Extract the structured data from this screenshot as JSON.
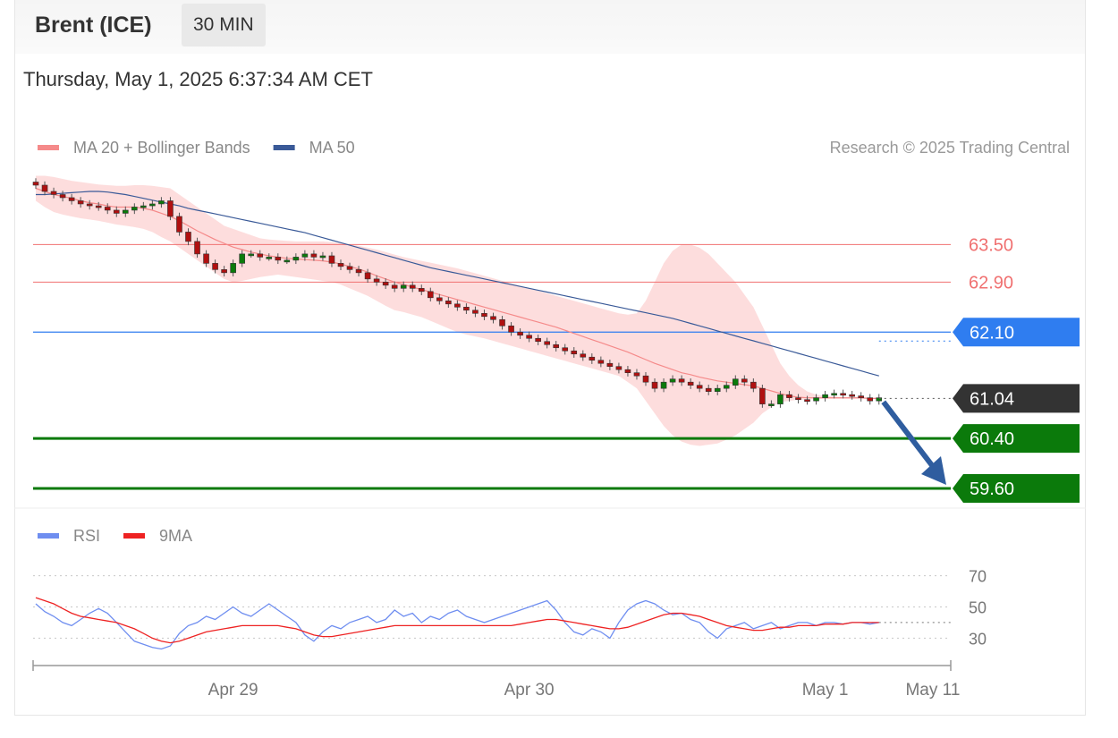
{
  "header": {
    "instrument": "Brent (ICE)",
    "timeframe": "30 MIN",
    "datetime": "Thursday, May 1, 2025 6:37:34 AM CET"
  },
  "copyright": "Research © 2025 Trading Central",
  "colors": {
    "ma20": "#f58a8a",
    "band": "#fcd4d4",
    "ma50": "#3a5a98",
    "resistance": "#f07070",
    "pivot": "#2f7df0",
    "support": "#0b7a0b",
    "price": "#333333",
    "rsi": "#6f8ef0",
    "rsi_ma": "#ee2222",
    "candle_up": "#0b7a0b",
    "candle_down": "#b01010"
  },
  "chart_data": [
    {
      "type": "candlestick",
      "title": "",
      "legend": [
        {
          "name": "MA 20 + Bollinger Bands",
          "color": "#f58a8a"
        },
        {
          "name": "MA 50",
          "color": "#3a5a98"
        }
      ],
      "legend_position": "top-left",
      "ylim": [
        59.4,
        64.55
      ],
      "x_ticks": [
        {
          "label": "Apr 29",
          "index": 22
        },
        {
          "label": "Apr 30",
          "index": 55
        },
        {
          "label": "May 1",
          "index": 88
        },
        {
          "label": "May 11",
          "index": 100
        }
      ],
      "x_range": [
        0,
        102
      ],
      "levels": [
        {
          "value": 63.5,
          "label": "63.50",
          "kind": "resistance"
        },
        {
          "value": 62.9,
          "label": "62.90",
          "kind": "resistance"
        },
        {
          "value": 62.1,
          "label": "62.10",
          "kind": "pivot"
        },
        {
          "value": 61.04,
          "label": "61.04",
          "kind": "price"
        },
        {
          "value": 60.4,
          "label": "60.40",
          "kind": "support"
        },
        {
          "value": 59.6,
          "label": "59.60",
          "kind": "support"
        }
      ],
      "close": [
        64.45,
        64.35,
        64.3,
        64.25,
        64.2,
        64.15,
        64.12,
        64.1,
        64.05,
        64.0,
        64.05,
        64.1,
        64.12,
        64.15,
        64.2,
        63.95,
        63.7,
        63.55,
        63.35,
        63.2,
        63.1,
        63.05,
        63.2,
        63.35,
        63.35,
        63.3,
        63.3,
        63.25,
        63.25,
        63.3,
        63.35,
        63.3,
        63.32,
        63.2,
        63.15,
        63.1,
        63.05,
        62.95,
        62.9,
        62.85,
        62.8,
        62.85,
        62.8,
        62.75,
        62.65,
        62.6,
        62.55,
        62.5,
        62.45,
        62.4,
        62.35,
        62.3,
        62.2,
        62.1,
        62.05,
        62.0,
        61.95,
        61.9,
        61.85,
        61.8,
        61.75,
        61.7,
        61.65,
        61.6,
        61.55,
        61.5,
        61.45,
        61.4,
        61.3,
        61.2,
        61.3,
        61.35,
        61.3,
        61.25,
        61.2,
        61.15,
        61.2,
        61.25,
        61.35,
        61.3,
        61.2,
        60.95,
        60.95,
        61.1,
        61.05,
        61.02,
        61.0,
        61.05,
        61.1,
        61.12,
        61.1,
        61.08,
        61.05,
        61.0,
        61.05
      ],
      "ma20": [
        64.4,
        64.35,
        64.3,
        64.27,
        64.24,
        64.2,
        64.17,
        64.15,
        64.12,
        64.1,
        64.1,
        64.1,
        64.08,
        64.05,
        64.0,
        63.95,
        63.88,
        63.8,
        63.72,
        63.65,
        63.58,
        63.52,
        63.46,
        63.42,
        63.38,
        63.35,
        63.32,
        63.3,
        63.28,
        63.27,
        63.26,
        63.25,
        63.24,
        63.22,
        63.19,
        63.15,
        63.11,
        63.06,
        63.0,
        62.95,
        62.9,
        62.86,
        62.82,
        62.78,
        62.74,
        62.7,
        62.66,
        62.62,
        62.58,
        62.54,
        62.5,
        62.46,
        62.42,
        62.38,
        62.34,
        62.3,
        62.26,
        62.22,
        62.18,
        62.13,
        62.08,
        62.03,
        61.98,
        61.93,
        61.88,
        61.83,
        61.78,
        61.72,
        61.66,
        61.6,
        61.55,
        61.5,
        61.45,
        61.42,
        61.38,
        61.35,
        61.32,
        61.3,
        61.28,
        61.26,
        61.24,
        61.2,
        61.16,
        61.12,
        61.08,
        61.06,
        61.05,
        61.05,
        61.05,
        61.05,
        61.05,
        61.05,
        61.05,
        61.04,
        61.04
      ],
      "band_upper": [
        64.6,
        64.6,
        64.58,
        64.55,
        64.52,
        64.5,
        64.48,
        64.46,
        64.45,
        64.44,
        64.44,
        64.45,
        64.45,
        64.44,
        64.42,
        64.4,
        64.3,
        64.2,
        64.1,
        64.0,
        63.9,
        63.8,
        63.75,
        63.7,
        63.65,
        63.6,
        63.58,
        63.57,
        63.56,
        63.55,
        63.55,
        63.55,
        63.55,
        63.54,
        63.52,
        63.5,
        63.48,
        63.45,
        63.42,
        63.38,
        63.34,
        63.3,
        63.27,
        63.24,
        63.21,
        63.18,
        63.15,
        63.12,
        63.08,
        63.04,
        63.0,
        62.96,
        62.92,
        62.88,
        62.84,
        62.8,
        62.76,
        62.72,
        62.68,
        62.64,
        62.6,
        62.56,
        62.52,
        62.48,
        62.44,
        62.4,
        62.38,
        62.4,
        62.6,
        62.9,
        63.2,
        63.4,
        63.5,
        63.5,
        63.45,
        63.35,
        63.2,
        63.05,
        62.9,
        62.7,
        62.5,
        62.2,
        61.9,
        61.6,
        61.4,
        61.25,
        61.15,
        61.1,
        61.08,
        61.07,
        61.06,
        61.06,
        61.06,
        61.05,
        61.05
      ],
      "band_lower": [
        64.2,
        64.1,
        64.02,
        63.98,
        63.95,
        63.92,
        63.9,
        63.88,
        63.85,
        63.82,
        63.8,
        63.78,
        63.75,
        63.7,
        63.62,
        63.55,
        63.45,
        63.35,
        63.25,
        63.15,
        63.05,
        62.95,
        62.9,
        62.92,
        62.95,
        62.98,
        63.0,
        63.02,
        63.0,
        62.98,
        62.96,
        62.94,
        62.92,
        62.9,
        62.86,
        62.8,
        62.74,
        62.68,
        62.6,
        62.52,
        62.45,
        62.42,
        62.38,
        62.34,
        62.28,
        62.22,
        62.16,
        62.1,
        62.06,
        62.03,
        62.0,
        61.96,
        61.92,
        61.88,
        61.84,
        61.8,
        61.76,
        61.72,
        61.68,
        61.64,
        61.6,
        61.56,
        61.52,
        61.48,
        61.44,
        61.4,
        61.3,
        61.2,
        61.0,
        60.8,
        60.6,
        60.45,
        60.35,
        60.3,
        60.28,
        60.3,
        60.32,
        60.38,
        60.45,
        60.55,
        60.65,
        60.8,
        60.9,
        60.98,
        61.0,
        61.02,
        61.02,
        61.03,
        61.03,
        61.03,
        61.03,
        61.03,
        61.03,
        61.03,
        61.03
      ],
      "ma50": [
        64.3,
        64.3,
        64.31,
        64.32,
        64.33,
        64.34,
        64.35,
        64.35,
        64.34,
        64.32,
        64.3,
        64.27,
        64.24,
        64.21,
        64.18,
        64.15,
        64.12,
        64.08,
        64.05,
        64.02,
        63.99,
        63.96,
        63.93,
        63.9,
        63.87,
        63.84,
        63.81,
        63.78,
        63.75,
        63.72,
        63.69,
        63.65,
        63.61,
        63.57,
        63.53,
        63.49,
        63.45,
        63.41,
        63.37,
        63.33,
        63.29,
        63.25,
        63.21,
        63.17,
        63.13,
        63.1,
        63.07,
        63.04,
        63.01,
        62.98,
        62.95,
        62.92,
        62.89,
        62.86,
        62.83,
        62.8,
        62.77,
        62.74,
        62.71,
        62.68,
        62.65,
        62.62,
        62.59,
        62.56,
        62.53,
        62.5,
        62.47,
        62.44,
        62.41,
        62.38,
        62.35,
        62.32,
        62.28,
        62.24,
        62.2,
        62.16,
        62.12,
        62.08,
        62.04,
        62.0,
        61.96,
        61.92,
        61.88,
        61.84,
        61.8,
        61.76,
        61.72,
        61.68,
        61.64,
        61.6,
        61.56,
        61.52,
        61.48,
        61.44,
        61.4
      ]
    },
    {
      "type": "line",
      "title": "",
      "legend": [
        {
          "name": "RSI",
          "color": "#6f8ef0"
        },
        {
          "name": "9MA",
          "color": "#ee2222"
        }
      ],
      "legend_position": "top-left",
      "ylim": [
        17,
        79
      ],
      "y_ticks": [
        70,
        50,
        30
      ],
      "x_range": [
        0,
        102
      ],
      "series": [
        {
          "name": "RSI",
          "values": [
            52,
            47,
            44,
            40,
            38,
            42,
            46,
            49,
            46,
            40,
            34,
            28,
            26,
            24,
            23,
            25,
            33,
            38,
            40,
            44,
            42,
            46,
            50,
            46,
            44,
            48,
            52,
            48,
            44,
            40,
            32,
            28,
            34,
            38,
            36,
            40,
            42,
            44,
            40,
            42,
            48,
            44,
            46,
            40,
            44,
            42,
            46,
            48,
            44,
            42,
            40,
            42,
            44,
            46,
            48,
            50,
            52,
            54,
            48,
            40,
            34,
            32,
            36,
            34,
            30,
            40,
            48,
            52,
            54,
            52,
            48,
            45,
            46,
            42,
            40,
            34,
            30,
            36,
            38,
            40,
            36,
            38,
            40,
            36,
            38,
            40,
            40,
            38,
            40,
            40,
            39,
            40,
            40,
            39,
            40
          ]
        },
        {
          "name": "9MA",
          "values": [
            56,
            54,
            52,
            49,
            46,
            44,
            43,
            42,
            41,
            40,
            38,
            36,
            33,
            30,
            28,
            27,
            28,
            30,
            32,
            34,
            35,
            36,
            37,
            38,
            38,
            38,
            38,
            38,
            37,
            36,
            34,
            32,
            31,
            31,
            32,
            33,
            34,
            35,
            36,
            37,
            38,
            38,
            38,
            38,
            38,
            38,
            38,
            38,
            38,
            38,
            38,
            38,
            38,
            38,
            39,
            40,
            41,
            42,
            42,
            41,
            40,
            39,
            38,
            37,
            36,
            36,
            37,
            39,
            41,
            43,
            45,
            46,
            46,
            45,
            44,
            42,
            40,
            38,
            37,
            36,
            35,
            35,
            36,
            37,
            37,
            38,
            38,
            38,
            39,
            39,
            39,
            40,
            40,
            40,
            40
          ]
        }
      ]
    }
  ]
}
